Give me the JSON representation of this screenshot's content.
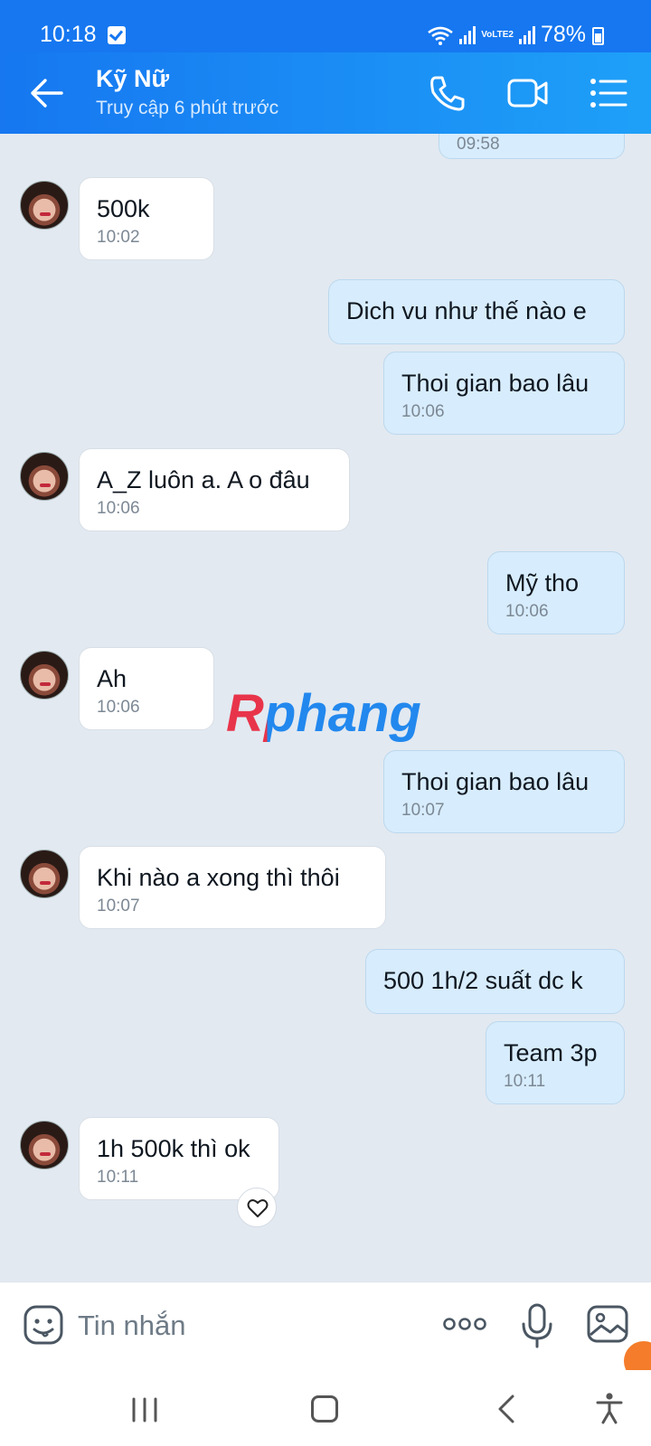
{
  "status": {
    "time": "10:18",
    "battery": "78%",
    "network": "VoLTE2"
  },
  "header": {
    "title": "Kỹ Nữ",
    "subtitle": "Truy cập 6 phút trước"
  },
  "messages": [
    {
      "side": "out",
      "text": "",
      "time": "09:58"
    },
    {
      "side": "in",
      "text": "500k",
      "time": "10:02"
    },
    {
      "side": "out",
      "text": "Dich vu như thế nào e",
      "time": ""
    },
    {
      "side": "out",
      "text": "Thoi gian bao lâu",
      "time": "10:06"
    },
    {
      "side": "in",
      "text": "A_Z luôn a. A o đâu",
      "time": "10:06"
    },
    {
      "side": "out",
      "text": "Mỹ tho",
      "time": "10:06"
    },
    {
      "side": "in",
      "text": "Ah",
      "time": "10:06"
    },
    {
      "side": "out",
      "text": "Thoi gian bao lâu",
      "time": "10:07"
    },
    {
      "side": "in",
      "text": "Khi nào a xong thì thôi",
      "time": "10:07"
    },
    {
      "side": "out",
      "text": "500 1h/2 suất dc k",
      "time": ""
    },
    {
      "side": "out",
      "text": "Team 3p",
      "time": "10:11"
    },
    {
      "side": "in",
      "text": "1h 500k thì ok",
      "time": "10:11"
    }
  ],
  "watermark": "Rphang",
  "composer": {
    "placeholder": "Tin nhắn"
  },
  "icons": {
    "back": "arrow-left-icon",
    "call": "phone-icon",
    "video": "video-camera-icon",
    "menu": "list-menu-icon",
    "sticker": "sticker-smiley-icon",
    "more": "more-dots-icon",
    "mic": "microphone-icon",
    "image": "image-icon",
    "react": "heart-icon"
  },
  "colors": {
    "header": "#1677f0",
    "outgoing_bubble": "#d7ecfc",
    "incoming_bubble": "#ffffff",
    "chat_bg": "#e2e9f1"
  }
}
